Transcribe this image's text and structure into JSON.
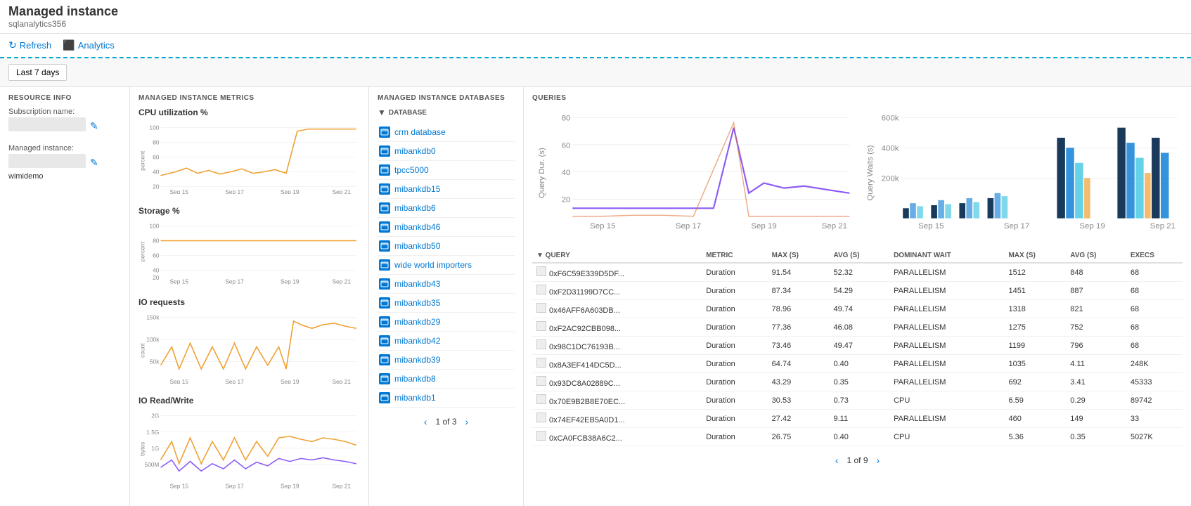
{
  "header": {
    "title": "Managed instance",
    "subtitle": "sqlanalytics356"
  },
  "toolbar": {
    "refresh_label": "Refresh",
    "analytics_label": "Analytics"
  },
  "filter": {
    "time_range": "Last 7 days"
  },
  "resource_info": {
    "section_title": "RESOURCE INFO",
    "subscription_label": "Subscription name:",
    "managed_instance_label": "Managed instance:",
    "managed_instance_value": "wimidemo"
  },
  "metrics": {
    "section_title": "MANAGED INSTANCE METRICS",
    "charts": [
      {
        "title": "CPU utilization %",
        "y_label": "percent",
        "dates": [
          "Sep 15",
          "Sep 17",
          "Sep 19",
          "Sep 21"
        ]
      },
      {
        "title": "Storage %",
        "y_label": "percent",
        "dates": [
          "Sep 15",
          "Sep 17",
          "Sep 19",
          "Sep 21"
        ]
      },
      {
        "title": "IO requests",
        "y_label": "count",
        "y_values": [
          "150k",
          "100k",
          "50k"
        ],
        "dates": [
          "Sep 15",
          "Sep 17",
          "Sep 19",
          "Sep 21"
        ]
      },
      {
        "title": "IO Read/Write",
        "y_label": "bytes",
        "y_values": [
          "2G",
          "1.5G",
          "1G",
          "500M"
        ],
        "dates": [
          "Sep 15",
          "Sep 17",
          "Sep 19",
          "Sep 21"
        ]
      }
    ]
  },
  "databases": {
    "section_title": "MANAGED INSTANCE DATABASES",
    "col_label": "DATABASE",
    "items": [
      "crm database",
      "mibankdb0",
      "tpcc5000",
      "mibankdb15",
      "mibankdb6",
      "mibankdb46",
      "mibankdb50",
      "wide world importers",
      "mibankdb43",
      "mibankdb35",
      "mibankdb29",
      "mibankdb42",
      "mibankdb39",
      "mibankdb8",
      "mibankdb1"
    ],
    "pagination": {
      "current": "1 of 3",
      "prev_label": "‹",
      "next_label": "›"
    }
  },
  "queries": {
    "section_title": "QUERIES",
    "chart_y_labels_left": [
      "80",
      "60",
      "40",
      "20"
    ],
    "chart_y_axis_left": "Query Dur. (s)",
    "chart_dates": [
      "Sep 15",
      "Sep 17",
      "Sep 19",
      "Sep 21"
    ],
    "chart_y_labels_right": [
      "600k",
      "400k",
      "200k"
    ],
    "chart_y_axis_right": "Query Waits (s)",
    "table": {
      "columns": [
        "QUERY",
        "METRIC",
        "MAX (S)",
        "AVG (S)",
        "DOMINANT WAIT",
        "MAX (S)",
        "AVG (S)",
        "EXECS"
      ],
      "rows": [
        {
          "query": "0xF6C59E339D5DF...",
          "metric": "Duration",
          "max": "91.54",
          "avg": "52.32",
          "dominant_wait": "PARALLELISM",
          "wait_max": "1512",
          "wait_avg": "848",
          "execs": "68"
        },
        {
          "query": "0xF2D31199D7CC...",
          "metric": "Duration",
          "max": "87.34",
          "avg": "54.29",
          "dominant_wait": "PARALLELISM",
          "wait_max": "1451",
          "wait_avg": "887",
          "execs": "68"
        },
        {
          "query": "0x46AFF6A603DB...",
          "metric": "Duration",
          "max": "78.96",
          "avg": "49.74",
          "dominant_wait": "PARALLELISM",
          "wait_max": "1318",
          "wait_avg": "821",
          "execs": "68"
        },
        {
          "query": "0xF2AC92CBB098...",
          "metric": "Duration",
          "max": "77.36",
          "avg": "46.08",
          "dominant_wait": "PARALLELISM",
          "wait_max": "1275",
          "wait_avg": "752",
          "execs": "68"
        },
        {
          "query": "0x98C1DC76193B...",
          "metric": "Duration",
          "max": "73.46",
          "avg": "49.47",
          "dominant_wait": "PARALLELISM",
          "wait_max": "1199",
          "wait_avg": "796",
          "execs": "68"
        },
        {
          "query": "0x8A3EF414DC5D...",
          "metric": "Duration",
          "max": "64.74",
          "avg": "0.40",
          "dominant_wait": "PARALLELISM",
          "wait_max": "1035",
          "wait_avg": "4.11",
          "execs": "248K"
        },
        {
          "query": "0x93DC8A02889C...",
          "metric": "Duration",
          "max": "43.29",
          "avg": "0.35",
          "dominant_wait": "PARALLELISM",
          "wait_max": "692",
          "wait_avg": "3.41",
          "execs": "45333"
        },
        {
          "query": "0x70E9B2B8E70EC...",
          "metric": "Duration",
          "max": "30.53",
          "avg": "0.73",
          "dominant_wait": "CPU",
          "wait_max": "6.59",
          "wait_avg": "0.29",
          "execs": "89742"
        },
        {
          "query": "0x74EF42EB5A0D1...",
          "metric": "Duration",
          "max": "27.42",
          "avg": "9.11",
          "dominant_wait": "PARALLELISM",
          "wait_max": "460",
          "wait_avg": "149",
          "execs": "33"
        },
        {
          "query": "0xCA0FCB38A6C2...",
          "metric": "Duration",
          "max": "26.75",
          "avg": "0.40",
          "dominant_wait": "CPU",
          "wait_max": "5.36",
          "wait_avg": "0.35",
          "execs": "5027K"
        }
      ],
      "pagination": {
        "current": "1 of 9",
        "prev_label": "‹",
        "next_label": "›"
      }
    }
  }
}
